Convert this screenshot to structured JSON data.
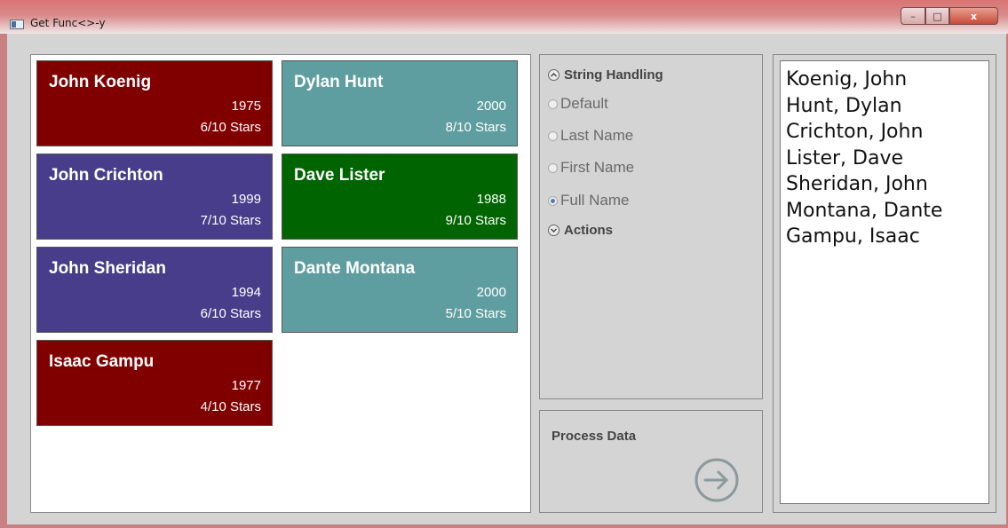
{
  "window": {
    "title": "Get Func<>-y",
    "controls": {
      "minimize": "–",
      "maximize": "□",
      "close": "x"
    }
  },
  "colors": {
    "maroon": "#800000",
    "teal": "#5f9ea0",
    "purple": "#483d8b",
    "green": "#006400"
  },
  "cards": [
    {
      "name": "John Koenig",
      "year": "1975",
      "rating": "6/10 Stars",
      "color": "#800000"
    },
    {
      "name": "Dylan Hunt",
      "year": "2000",
      "rating": "8/10 Stars",
      "color": "#5f9ea0"
    },
    {
      "name": "John Crichton",
      "year": "1999",
      "rating": "7/10 Stars",
      "color": "#483d8b"
    },
    {
      "name": "Dave Lister",
      "year": "1988",
      "rating": "9/10 Stars",
      "color": "#006400"
    },
    {
      "name": "John Sheridan",
      "year": "1994",
      "rating": "6/10 Stars",
      "color": "#483d8b"
    },
    {
      "name": "Dante Montana",
      "year": "2000",
      "rating": "5/10 Stars",
      "color": "#5f9ea0"
    },
    {
      "name": "Isaac Gampu",
      "year": "1977",
      "rating": "4/10 Stars",
      "color": "#800000"
    }
  ],
  "options": {
    "string_handling_header": "String Handling",
    "radios": [
      {
        "label": "Default",
        "checked": false
      },
      {
        "label": "Last Name",
        "checked": false
      },
      {
        "label": "First Name",
        "checked": false
      },
      {
        "label": "Full Name",
        "checked": true
      }
    ],
    "actions_header": "Actions"
  },
  "process": {
    "label": "Process Data",
    "icon": "arrow-right-circle-icon"
  },
  "output": {
    "lines": [
      "Koenig, John",
      "Hunt, Dylan",
      "Crichton, John",
      "Lister, Dave",
      "Sheridan, John",
      "Montana, Dante",
      "Gampu, Isaac"
    ]
  }
}
